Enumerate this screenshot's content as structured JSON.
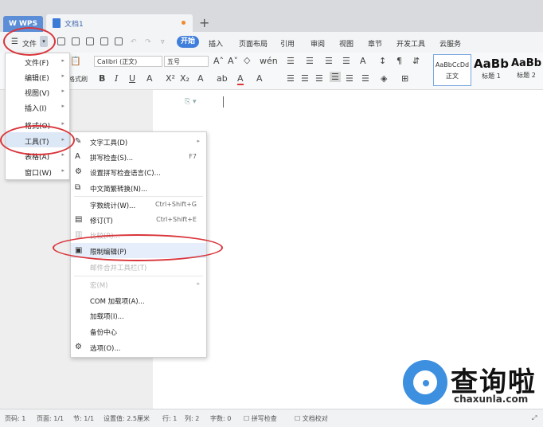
{
  "tabbar": {
    "wps_label": "WPS",
    "doc_tab": "文档1",
    "new_tab": "+"
  },
  "menustrip": {
    "file_label": "文件",
    "tabs": [
      "开始",
      "插入",
      "页面布局",
      "引用",
      "审阅",
      "视图",
      "章节",
      "开发工具",
      "云服务"
    ]
  },
  "ribbon": {
    "paste_label": "格式刷",
    "font_name": "Calibri (正文)",
    "font_size": "五号",
    "bold": "B",
    "italic": "I",
    "underline": "U",
    "styles": [
      {
        "preview": "AaBbCcDd",
        "name": "正文"
      },
      {
        "preview": "AaBb",
        "name": "标题 1"
      },
      {
        "preview": "AaBb",
        "name": "标题 2"
      }
    ]
  },
  "file_menu": {
    "items": [
      {
        "label": "文件(F)",
        "arrow": "▸"
      },
      {
        "label": "编辑(E)",
        "arrow": "▸"
      },
      {
        "label": "视图(V)",
        "arrow": "▸"
      },
      {
        "label": "插入(I)",
        "arrow": "▸"
      },
      {
        "label": "格式(O)",
        "arrow": "▸"
      },
      {
        "label": "工具(T)",
        "arrow": "▸"
      },
      {
        "label": "表格(A)",
        "arrow": "▸"
      },
      {
        "label": "窗口(W)",
        "arrow": "▸"
      }
    ]
  },
  "tools_menu": {
    "items": [
      {
        "label": "文字工具(D)",
        "shortcut": "",
        "arrow": "▸",
        "icon": "text-tool-icon"
      },
      {
        "label": "拼写检查(S)...",
        "shortcut": "F7",
        "arrow": "",
        "icon": "spellcheck-icon"
      },
      {
        "label": "设置拼写检查语言(C)...",
        "shortcut": "",
        "arrow": "",
        "icon": "language-icon"
      },
      {
        "label": "中文简繁转换(N)...",
        "shortcut": "",
        "arrow": "",
        "icon": "convert-icon"
      },
      {
        "label": "字数统计(W)...",
        "shortcut": "Ctrl+Shift+G",
        "arrow": "",
        "icon": ""
      },
      {
        "label": "修订(T)",
        "shortcut": "Ctrl+Shift+E",
        "arrow": "",
        "icon": "revision-icon"
      },
      {
        "label": "比较(R)...",
        "shortcut": "",
        "arrow": "",
        "icon": "compare-icon"
      },
      {
        "label": "限制编辑(P)",
        "shortcut": "",
        "arrow": "",
        "icon": "restrict-edit-icon"
      },
      {
        "label": "邮件合并工具栏(T)",
        "shortcut": "",
        "arrow": "",
        "icon": ""
      },
      {
        "label": "宏(M)",
        "shortcut": "",
        "arrow": "▸",
        "icon": ""
      },
      {
        "label": "COM 加载项(A)...",
        "shortcut": "",
        "arrow": "",
        "icon": ""
      },
      {
        "label": "加载项(I)...",
        "shortcut": "",
        "arrow": "",
        "icon": ""
      },
      {
        "label": "备份中心",
        "shortcut": "",
        "arrow": "",
        "icon": ""
      },
      {
        "label": "选项(O)...",
        "shortcut": "",
        "arrow": "",
        "icon": "options-gear-icon"
      }
    ]
  },
  "statusbar": {
    "page_num": "页码: 1",
    "pages": "页面: 1/1",
    "section": "节: 1/1",
    "setting": "设置值: 2.5厘米",
    "row": "行: 1",
    "col": "列: 2",
    "words": "字数: 0",
    "spell": "拼写检查",
    "proof": "文档校对"
  },
  "watermark": {
    "cn": "查询啦",
    "url": "chaxunla.com"
  },
  "colors": {
    "accent": "#3f7fdb",
    "annotation_red": "#d9343a",
    "wps_tab": "#5b8ed6"
  }
}
